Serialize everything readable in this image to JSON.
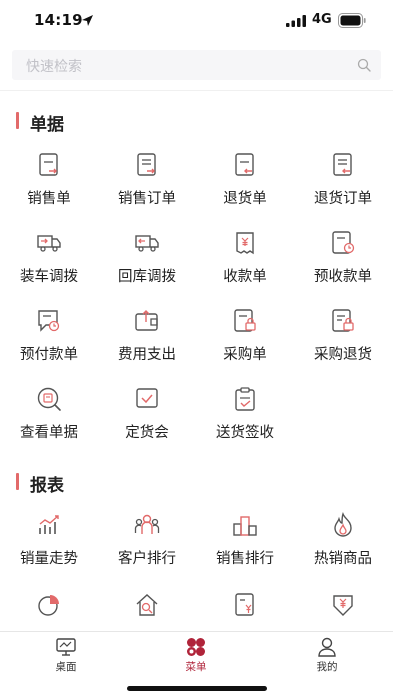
{
  "status": {
    "time": "14:19",
    "network": "4G"
  },
  "search": {
    "placeholder": "快速检索"
  },
  "sections": [
    {
      "title": "单据",
      "items": [
        {
          "label": "销售单",
          "icon": "sales-order-icon"
        },
        {
          "label": "销售订单",
          "icon": "sales-booking-icon"
        },
        {
          "label": "退货单",
          "icon": "return-order-icon"
        },
        {
          "label": "退货订单",
          "icon": "return-booking-icon"
        },
        {
          "label": "装车调拨",
          "icon": "truck-load-icon"
        },
        {
          "label": "回库调拨",
          "icon": "truck-return-icon"
        },
        {
          "label": "收款单",
          "icon": "receipt-yuan-icon"
        },
        {
          "label": "预收款单",
          "icon": "prepaid-receipt-icon"
        },
        {
          "label": "预付款单",
          "icon": "prepayment-icon"
        },
        {
          "label": "费用支出",
          "icon": "wallet-expense-icon"
        },
        {
          "label": "采购单",
          "icon": "purchase-order-icon"
        },
        {
          "label": "采购退货",
          "icon": "purchase-return-icon"
        },
        {
          "label": "查看单据",
          "icon": "view-docs-icon"
        },
        {
          "label": "定货会",
          "icon": "order-fair-icon"
        },
        {
          "label": "送货签收",
          "icon": "delivery-sign-icon"
        }
      ]
    },
    {
      "title": "报表",
      "items": [
        {
          "label": "销量走势",
          "icon": "trend-chart-icon"
        },
        {
          "label": "客户排行",
          "icon": "customer-rank-icon"
        },
        {
          "label": "销售排行",
          "icon": "sales-rank-icon"
        },
        {
          "label": "热销商品",
          "icon": "flame-icon"
        },
        {
          "label": "",
          "icon": "pie-chart-icon"
        },
        {
          "label": "",
          "icon": "house-search-icon"
        },
        {
          "label": "",
          "icon": "receipt-list-icon"
        },
        {
          "label": "",
          "icon": "yuan-down-icon"
        }
      ]
    }
  ],
  "tabbar": [
    {
      "label": "桌面",
      "icon": "monitor-icon",
      "active": false
    },
    {
      "label": "菜单",
      "icon": "menu-apps-icon",
      "active": true
    },
    {
      "label": "我的",
      "icon": "user-icon",
      "active": false
    }
  ],
  "colors": {
    "accent": "#e26a6a",
    "brand": "#b0243a",
    "icon_gray": "#555555"
  }
}
